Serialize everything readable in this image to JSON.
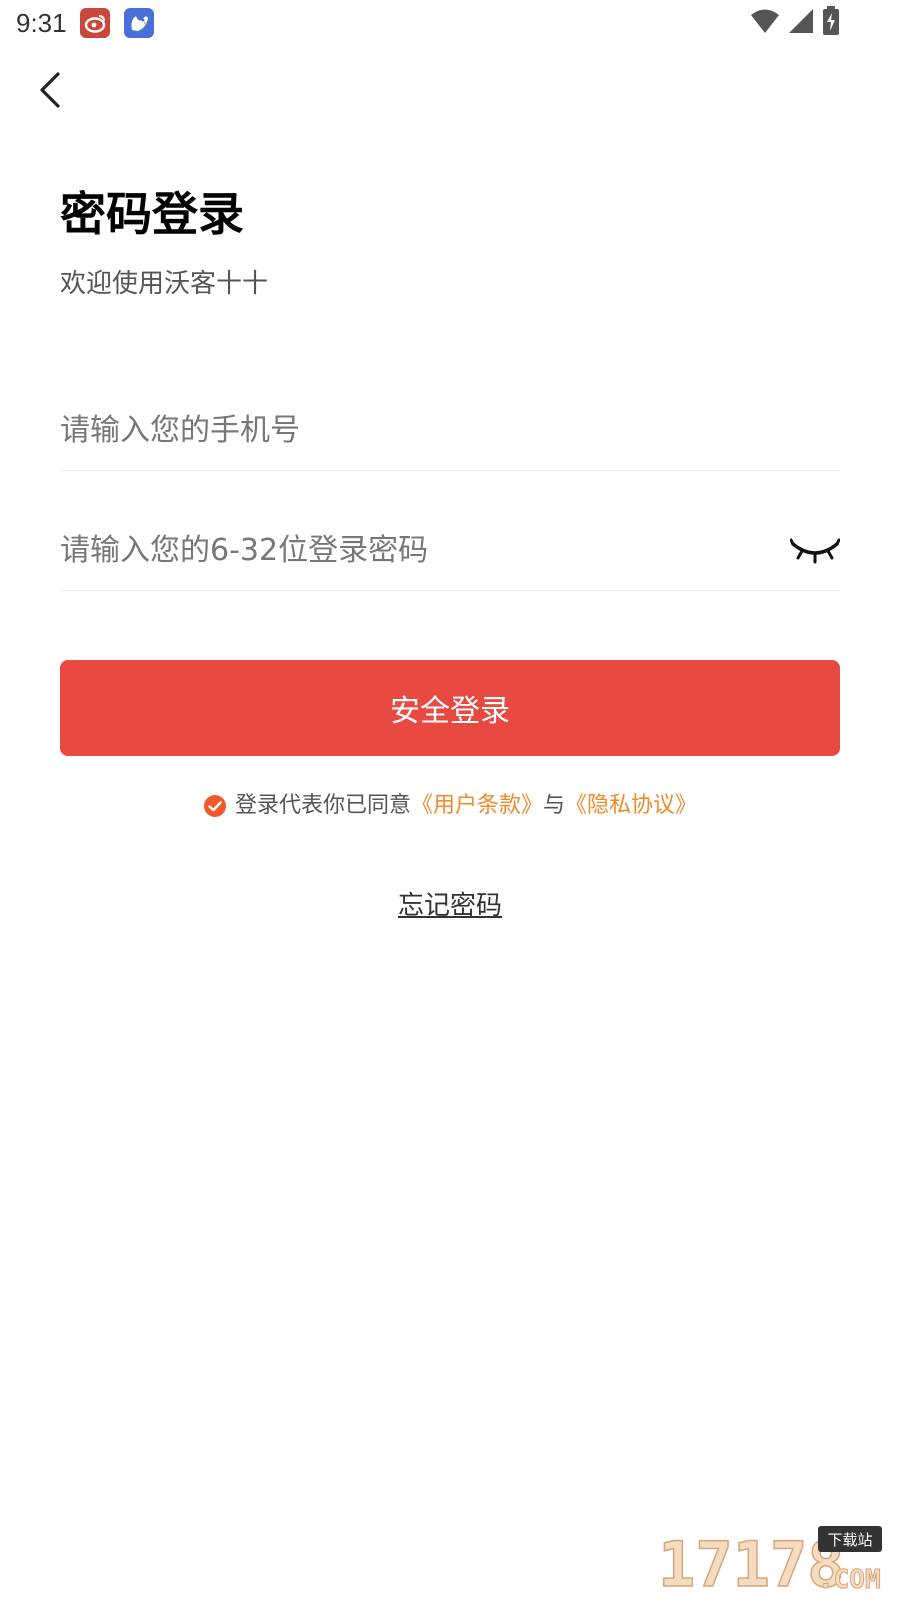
{
  "status_bar": {
    "time": "9:31",
    "notification_icons": [
      "weibo-icon",
      "bird-app-icon"
    ],
    "right_icons": [
      "wifi-icon",
      "signal-icon",
      "battery-charging-icon"
    ]
  },
  "header": {
    "back_icon": "chevron-left-icon"
  },
  "title": "密码登录",
  "subtitle": "欢迎使用沃客十十",
  "form": {
    "phone_placeholder": "请输入您的手机号",
    "phone_value": "",
    "password_placeholder": "请输入您的6-32位登录密码",
    "password_value": "",
    "password_visibility_icon": "eye-closed-icon"
  },
  "login_button_label": "安全登录",
  "agreement": {
    "checked": true,
    "prefix": "登录代表你已同意",
    "terms_link": "《用户条款》",
    "connector": "与",
    "privacy_link": "《隐私协议》"
  },
  "forgot_password_label": "忘记密码",
  "watermark": {
    "number": "17178",
    "tag": "下载站",
    "suffix": ".COM"
  },
  "colors": {
    "primary": "#e84a42",
    "link": "#f08a2b",
    "check": "#f05a2b",
    "placeholder": "#777777",
    "divider": "#ececec"
  }
}
